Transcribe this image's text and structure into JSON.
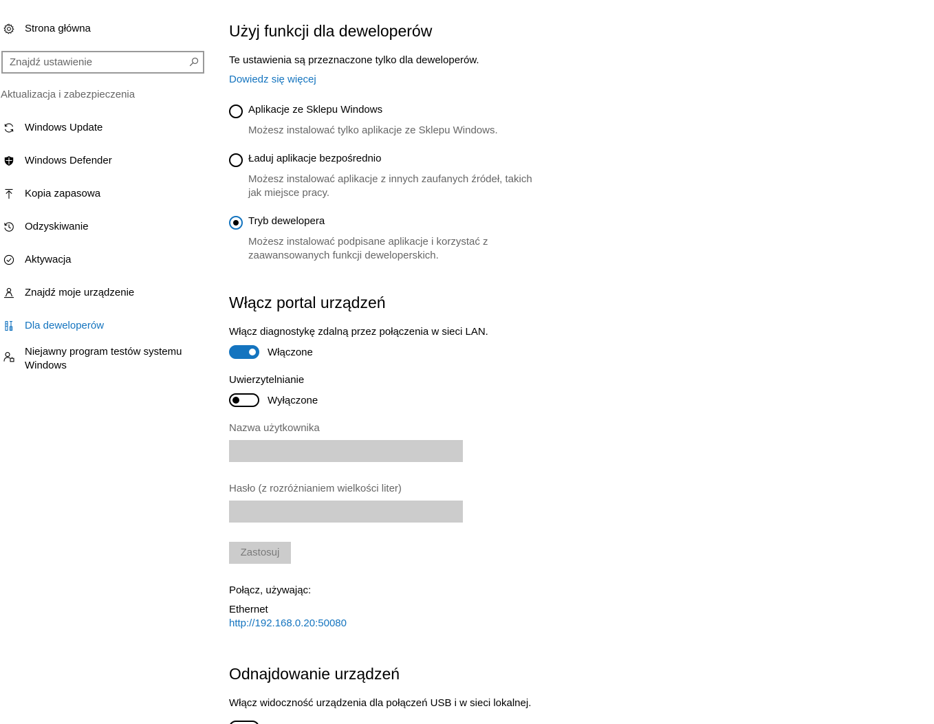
{
  "sidebar": {
    "home_label": "Strona główna",
    "search_placeholder": "Znajdź ustawienie",
    "section_heading": "Aktualizacja i zabezpieczenia",
    "items": [
      {
        "label": "Windows Update",
        "icon": "sync-icon"
      },
      {
        "label": "Windows Defender",
        "icon": "shield-icon"
      },
      {
        "label": "Kopia zapasowa",
        "icon": "upload-arrow-icon"
      },
      {
        "label": "Odzyskiwanie",
        "icon": "history-icon"
      },
      {
        "label": "Aktywacja",
        "icon": "check-circle-icon"
      },
      {
        "label": "Znajdź moje urządzenie",
        "icon": "person-location-icon"
      },
      {
        "label": "Dla deweloperów",
        "icon": "developer-tools-icon",
        "active": true
      },
      {
        "label": "Niejawny program testów systemu Windows",
        "icon": "insider-icon"
      }
    ]
  },
  "developer": {
    "title": "Użyj funkcji dla deweloperów",
    "intro": "Te ustawienia są przeznaczone tylko dla deweloperów.",
    "learn_more": "Dowiedz się więcej",
    "options": [
      {
        "label": "Aplikacje ze Sklepu Windows",
        "description": "Możesz instalować tylko aplikacje ze Sklepu Windows.",
        "selected": false
      },
      {
        "label": "Ładuj aplikacje bezpośrednio",
        "description": "Możesz instalować aplikacje z innych zaufanych źródeł, takich jak miejsce pracy.",
        "selected": false
      },
      {
        "label": "Tryb dewelopera",
        "description": "Możesz instalować podpisane aplikacje i korzystać z zaawansowanych funkcji deweloperskich.",
        "selected": true
      }
    ]
  },
  "portal": {
    "title": "Włącz portal urządzeń",
    "remote_diag_label": "Włącz diagnostykę zdalną przez połączenia w sieci LAN.",
    "remote_diag_state": "Włączone",
    "auth_label": "Uwierzytelnianie",
    "auth_state": "Wyłączone",
    "username_label": "Nazwa użytkownika",
    "password_label": "Hasło (z rozróżnianiem wielkości liter)",
    "apply_label": "Zastosuj",
    "connect_label": "Połącz, używając:",
    "interface_name": "Ethernet",
    "address": "http://192.168.0.20:50080"
  },
  "discovery": {
    "title": "Odnajdowanie urządzeń",
    "visibility_label": "Włącz widoczność urządzenia dla połączeń USB i w sieci lokalnej."
  },
  "colors": {
    "accent": "#1474bf",
    "secondary_text": "#666666",
    "disabled_field": "#cccccc"
  }
}
